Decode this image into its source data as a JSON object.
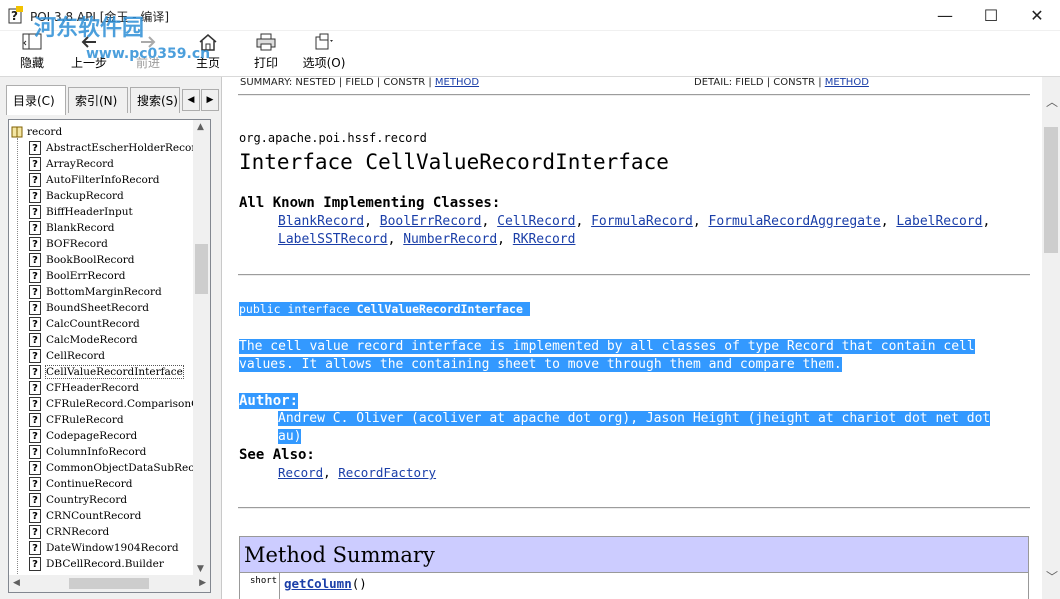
{
  "window": {
    "title": "POI 3.8 API [金玉 - 编译]",
    "minimize": "—",
    "maximize": "☐",
    "close": "✕"
  },
  "watermark": {
    "logo": "河东软件园",
    "url": "www.pc0359.cn"
  },
  "toolbar": {
    "hide": "隐藏",
    "back": "上一步",
    "forward": "前进",
    "home": "主页",
    "print": "打印",
    "options": "选项(O)"
  },
  "tabs": {
    "contents": "目录(C)",
    "index": "索引(N)",
    "search": "搜索(S)",
    "prev": "◀",
    "next": "▶"
  },
  "tree": {
    "root": "record",
    "items": [
      "AbstractEscherHolderRecord",
      "ArrayRecord",
      "AutoFilterInfoRecord",
      "BackupRecord",
      "BiffHeaderInput",
      "BlankRecord",
      "BOFRecord",
      "BookBoolRecord",
      "BoolErrRecord",
      "BottomMarginRecord",
      "BoundSheetRecord",
      "CalcCountRecord",
      "CalcModeRecord",
      "CellRecord",
      "CellValueRecordInterface",
      "CFHeaderRecord",
      "CFRuleRecord.ComparisonOperator",
      "CFRuleRecord",
      "CodepageRecord",
      "ColumnInfoRecord",
      "CommonObjectDataSubRecord",
      "ContinueRecord",
      "CountryRecord",
      "CRNCountRecord",
      "CRNRecord",
      "DateWindow1904Record",
      "DBCellRecord.Builder"
    ],
    "selected_index": 14
  },
  "doc": {
    "summary_prefix": "SUMMARY: NESTED | FIELD | CONSTR | ",
    "summary_method": "METHOD",
    "detail_prefix": "DETAIL: FIELD | CONSTR | ",
    "detail_method": "METHOD",
    "package": "org.apache.poi.hssf.record",
    "title": "Interface CellValueRecordInterface",
    "implementing_heading": "All Known Implementing Classes:",
    "implementing": [
      "BlankRecord",
      "BoolErrRecord",
      "CellRecord",
      "FormulaRecord",
      "FormulaRecordAggregate",
      "LabelRecord",
      "LabelSSTRecord",
      "NumberRecord",
      "RKRecord"
    ],
    "signature_prefix": "public interface ",
    "signature_name": "CellValueRecordInterface",
    "description_line1": "The cell value record interface is implemented by all classes of type Record that contain cell",
    "description_line2": "values. It allows the containing sheet to move through them and compare them.",
    "author_heading": "Author:",
    "author_line1": "Andrew C. Oliver (acoliver at apache dot org), Jason Height (jheight at chariot dot net dot",
    "author_line2": "au)",
    "see_also_heading": "See Also:",
    "see_also": [
      "Record",
      "RecordFactory"
    ],
    "method_summary_heading": "Method Summary",
    "method_type": "short",
    "method_name": "getColumn",
    "method_parens": "()"
  }
}
